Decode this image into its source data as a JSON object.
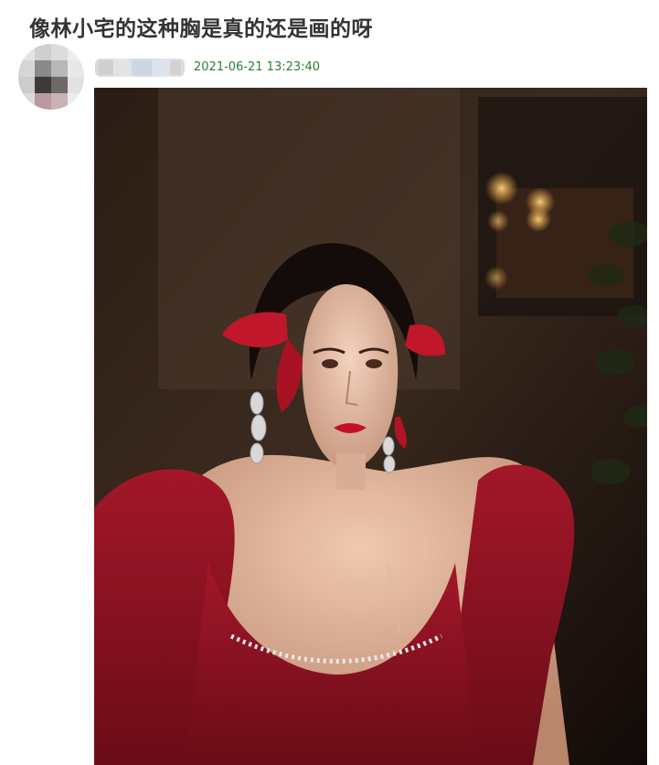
{
  "post": {
    "title": "像林小宅的这种胸是真的还是画的呀",
    "timestamp": "2021-06-21 13:23:40"
  },
  "colors": {
    "title": "#333333",
    "timestamp": "#2e7d32",
    "dress": "#8e1422",
    "bow": "#c0172a",
    "lips": "#c40f2b"
  },
  "icons": {
    "avatar": "pixelated-avatar",
    "username": "pixelated-username"
  }
}
